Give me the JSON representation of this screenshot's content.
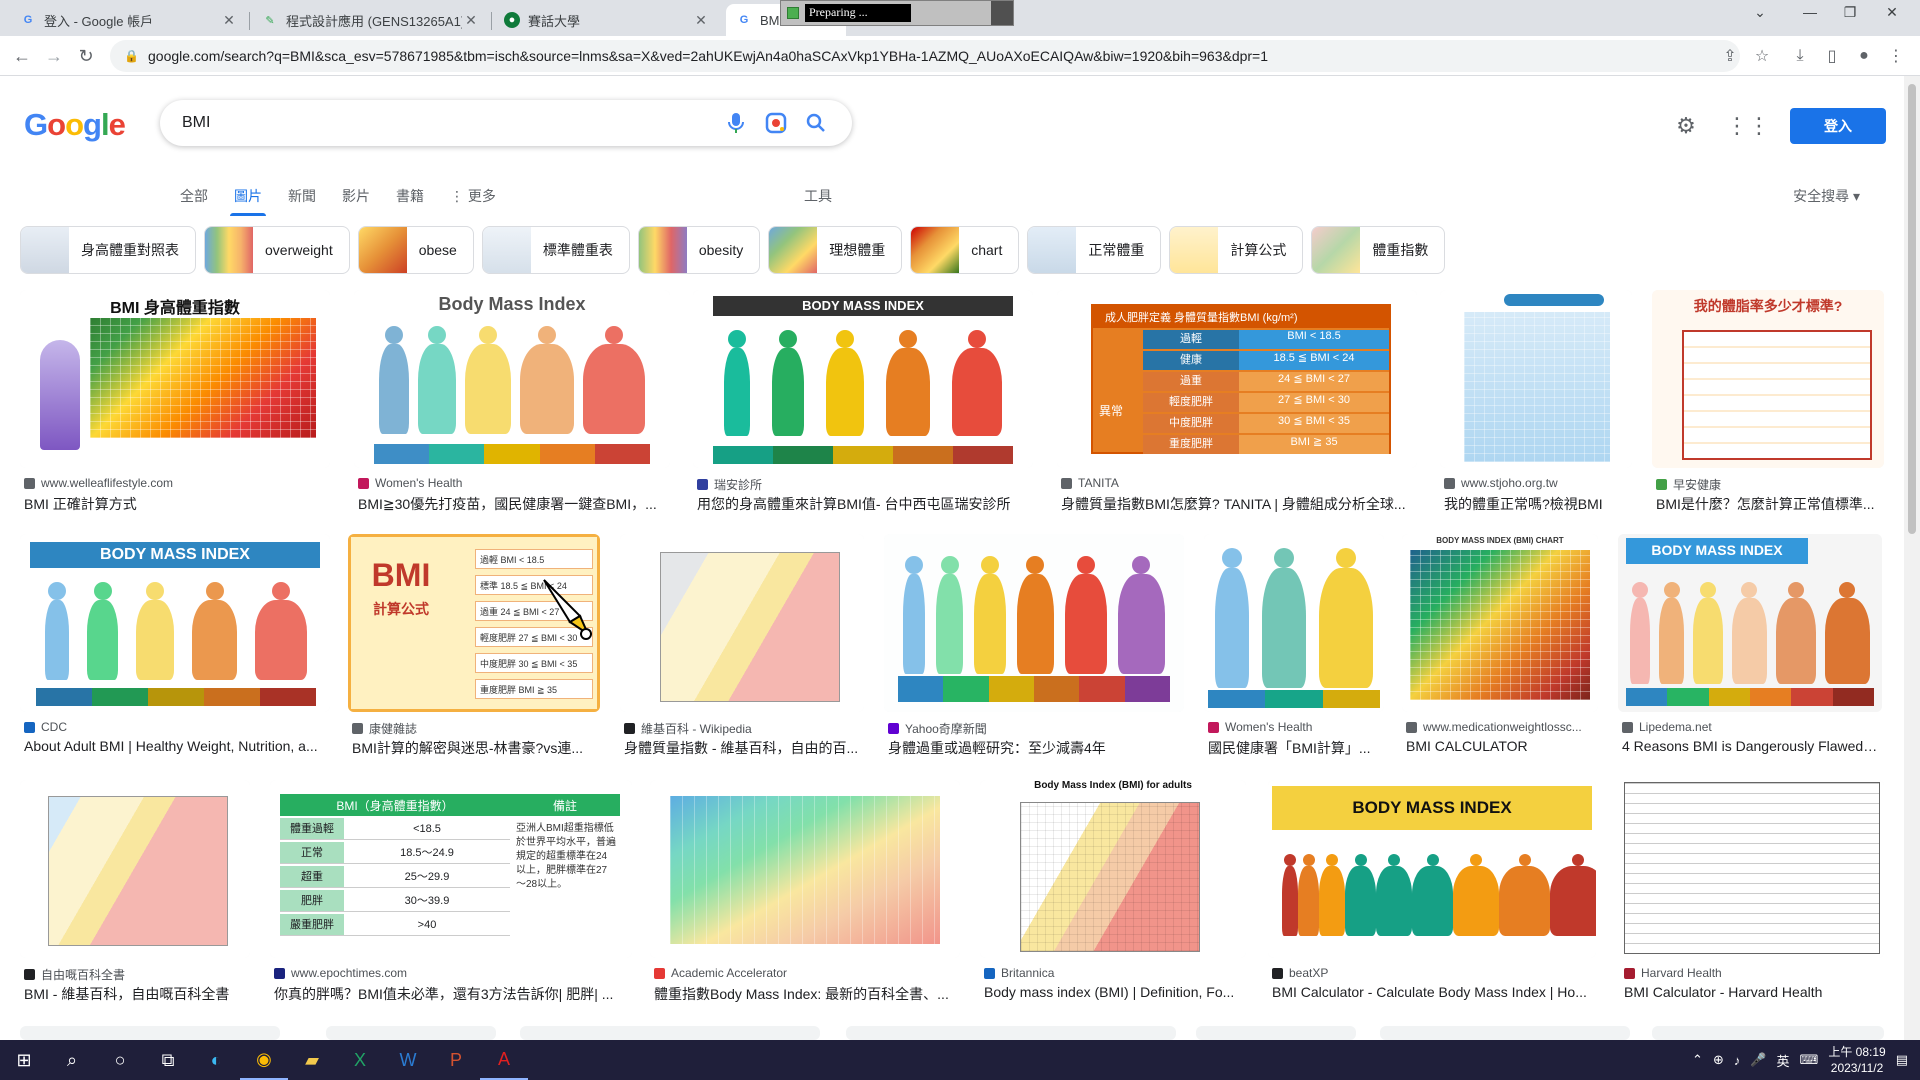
{
  "browser": {
    "tabs": [
      {
        "title": "登入 - Google 帳戶",
        "active": false,
        "fav_color": "#4285f4"
      },
      {
        "title": "程式設計應用 (GENS13265A1)",
        "active": false,
        "fav_color": "#34a853"
      },
      {
        "title": "賽話大學",
        "active": false,
        "fav_color": "#0f7a3a"
      },
      {
        "title": "BMI",
        "active": true,
        "fav_color": "#4285f4"
      }
    ],
    "preparing_text": "Preparing ...",
    "url": "google.com/search?q=BMI&sca_esv=578671985&tbm=isch&source=lnms&sa=X&ved=2ahUKEwjAn4a0haSCAxVkp1YBHa-1AZMQ_AUoAXoECAIQAw&biw=1920&bih=963&dpr=1"
  },
  "google": {
    "logo_letters": [
      "G",
      "o",
      "o",
      "g",
      "l",
      "e"
    ],
    "query": "BMI",
    "sign_in": "登入",
    "tabs": [
      "全部",
      "圖片",
      "新聞",
      "影片",
      "書籍",
      "更多"
    ],
    "active_tab": "圖片",
    "tools": "工具",
    "safe_search": "安全搜尋 ▾",
    "colors": {
      "accent": "#1a73e8",
      "text": "#202124",
      "secondary": "#5f6368"
    }
  },
  "chips": [
    {
      "label": "身高體重對照表",
      "thumb": "linear-gradient(#e8eef5,#cfd8e3)"
    },
    {
      "label": "overweight",
      "thumb": "linear-gradient(90deg,#6fa8dc,#93c47d,#ffd966,#f6b26b,#e06666)"
    },
    {
      "label": "obese",
      "thumb": "linear-gradient(135deg,#ffd966,#e69138,#cc4125)"
    },
    {
      "label": "標準體重表",
      "thumb": "linear-gradient(#eef3f8,#d6e0ea)"
    },
    {
      "label": "obesity",
      "thumb": "linear-gradient(90deg,#93c47d,#ffd966,#e06666,#8e7cc3)"
    },
    {
      "label": "理想體重",
      "thumb": "linear-gradient(135deg,#6fa8dc,#93c47d,#ffd966,#e06666)"
    },
    {
      "label": "chart",
      "thumb": "linear-gradient(135deg,#cc0000,#e69138,#ffd966,#38761d)"
    },
    {
      "label": "正常體重",
      "thumb": "linear-gradient(#e3edf7,#c9d9e8)"
    },
    {
      "label": "計算公式",
      "thumb": "linear-gradient(#fff2cc,#ffe599)"
    },
    {
      "label": "體重指數",
      "thumb": "linear-gradient(135deg,#f4cccc,#b6d7a8,#ffe599)"
    }
  ],
  "results": [
    {
      "source": "www.welleaflifestyle.com",
      "caption": "BMI 正確計算方式",
      "img_title": "BMI 身高體重指數",
      "fav": "#5f6368"
    },
    {
      "source": "Women's Health",
      "caption": "BMI≧30優先打疫苗，國民健康署一鍵查BMI，...",
      "img_title": "Body Mass Index",
      "fav": "#c2185b"
    },
    {
      "source": "瑞安診所",
      "caption": "用您的身高體重來計算BMI值- 台中西屯區瑞安診所",
      "img_title": "BODY MASS INDEX",
      "fav": "#303f9f"
    },
    {
      "source": "TANITA",
      "caption": "身體質量指數BMI怎麼算? TANITA | 身體組成分析全球...",
      "img_title": "成人肥胖定義   身體質量指數BMI (kg/m²)",
      "fav": "#5f6368"
    },
    {
      "source": "www.stjoho.org.tw",
      "caption": "我的體重正常嗎?檢視BMI",
      "img_title": "",
      "fav": "#5f6368"
    },
    {
      "source": "早安健康",
      "caption": "BMI是什麼？怎麼計算正常值標準...",
      "img_title": "我的體脂率多少才標準?",
      "fav": "#43a047"
    },
    {
      "source": "CDC",
      "caption": "About Adult BMI | Healthy Weight, Nutrition, a...",
      "img_title": "BODY MASS INDEX",
      "fav": "#1565c0"
    },
    {
      "source": "康健雜誌",
      "caption": "BMI計算的解密與迷思-林書豪?vs連...",
      "img_title": "BMI",
      "img_sub": "計算公式",
      "fav": "#5f6368"
    },
    {
      "source": "維基百科 - Wikipedia",
      "caption": "身體質量指數 - 維基百科，自由的百...",
      "img_title": "",
      "fav": "#202124"
    },
    {
      "source": "Yahoo奇摩新聞",
      "caption": "身體過重或過輕研究：至少減壽4年",
      "img_title": "",
      "fav": "#6001d2"
    },
    {
      "source": "Women's Health",
      "caption": "國民健康署「BMI計算」...",
      "img_title": "",
      "fav": "#c2185b"
    },
    {
      "source": "www.medicationweightlossc...",
      "caption": "BMI CALCULATOR",
      "img_title": "BODY MASS INDEX (BMI) CHART",
      "fav": "#5f6368"
    },
    {
      "source": "Lipedema.net",
      "caption": "4 Reasons BMI is Dangerously Flawed ...",
      "img_title": "BODY MASS INDEX",
      "fav": "#5f6368"
    },
    {
      "source": "自由嘅百科全書",
      "caption": "BMI - 維基百科，自由嘅百科全書",
      "img_title": "",
      "fav": "#202124"
    },
    {
      "source": "www.epochtimes.com",
      "caption": "你真的胖嗎？BMI值未必準，還有3方法告訴你| 肥胖| ...",
      "img_title": "BMI（身高體重指數）",
      "fav": "#1a237e"
    },
    {
      "source": "Academic Accelerator",
      "caption": "體重指數Body Mass Index: 最新的百科全書、...",
      "img_title": "",
      "fav": "#e53935"
    },
    {
      "source": "Britannica",
      "caption": "Body mass index (BMI) | Definition, Fo...",
      "img_title": "Body Mass Index (BMI) for adults",
      "fav": "#1565c0"
    },
    {
      "source": "beatXP",
      "caption": "BMI Calculator - Calculate Body Mass Index | Ho...",
      "img_title": "BODY MASS INDEX",
      "fav": "#202124"
    },
    {
      "source": "Harvard Health",
      "caption": "BMI Calculator - Harvard Health",
      "img_title": "",
      "fav": "#a51c30"
    }
  ],
  "tanita_rows": [
    [
      "過輕",
      "BMI < 18.5"
    ],
    [
      "健康",
      "18.5 ≦ BMI < 24"
    ],
    [
      "過重",
      "24 ≦ BMI < 27"
    ],
    [
      "輕度肥胖",
      "27 ≦ BMI < 30"
    ],
    [
      "中度肥胖",
      "30 ≦ BMI < 35"
    ],
    [
      "重度肥胖",
      "BMI ≧ 35"
    ]
  ],
  "tanita_group": "異常",
  "kangjian_rows": [
    "過輕 BMI < 18.5",
    "標準 18.5 ≦ BMI < 24",
    "過重 24 ≦ BMI < 27",
    "輕度肥胖 27 ≦ BMI < 30",
    "中度肥胖 30 ≦ BMI < 35",
    "重度肥胖 BMI ≧ 35"
  ],
  "epoch_rows": [
    [
      "體重過輕",
      "<18.5"
    ],
    [
      "正常",
      "18.5～24.9"
    ],
    [
      "超重",
      "25～29.9"
    ],
    [
      "肥胖",
      "30～39.9"
    ],
    [
      "嚴重肥胖",
      ">40"
    ]
  ],
  "epoch_note": "亞洲人BMI超重指標低於世界平均水平，普遍規定的超重標準在24以上，肥胖標準在27～28以上。",
  "epoch_header_right": "備註",
  "taskbar": {
    "apps": [
      "start-icon",
      "search-icon",
      "cortana-icon",
      "task-view-icon",
      "edge-icon",
      "chrome-icon",
      "explorer-icon",
      "excel-icon",
      "word-icon",
      "powerpoint-icon",
      "acrobat-icon"
    ],
    "time": "上午 08:19",
    "date": "2023/11/2",
    "ime": "英"
  }
}
